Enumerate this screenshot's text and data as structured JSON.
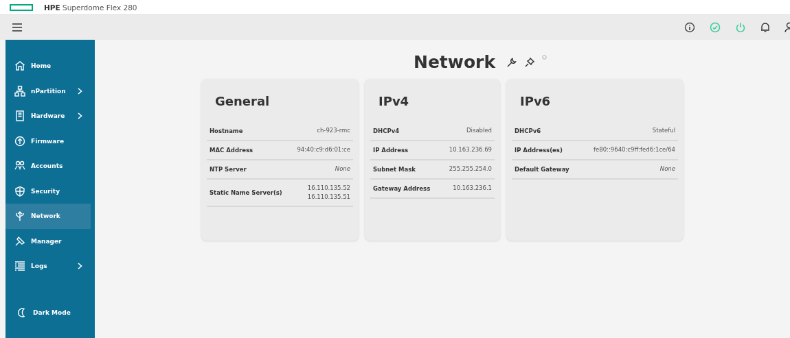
{
  "titlebar": {
    "brand": "HPE",
    "product": "Superdome Flex 280"
  },
  "sidebar": {
    "items": [
      {
        "label": "Home",
        "selected": false,
        "submenu": false
      },
      {
        "label": "nPartition",
        "selected": false,
        "submenu": true
      },
      {
        "label": "Hardware",
        "selected": false,
        "submenu": true
      },
      {
        "label": "Firmware",
        "selected": false,
        "submenu": false
      },
      {
        "label": "Accounts",
        "selected": false,
        "submenu": false
      },
      {
        "label": "Security",
        "selected": false,
        "submenu": false
      },
      {
        "label": "Network",
        "selected": true,
        "submenu": false
      },
      {
        "label": "Manager",
        "selected": false,
        "submenu": false
      },
      {
        "label": "Logs",
        "selected": false,
        "submenu": true
      }
    ],
    "dark_mode": "Dark Mode"
  },
  "page": {
    "title": "Network"
  },
  "cards": [
    {
      "title": "General",
      "rows": [
        {
          "label": "Hostname",
          "values": [
            "ch-923-rmc"
          ],
          "kind": "text"
        },
        {
          "label": "MAC Address",
          "values": [
            "94:40:c9:d6:01:ce"
          ],
          "kind": "text"
        },
        {
          "label": "NTP Server",
          "values": [
            "None"
          ],
          "kind": "none"
        },
        {
          "label": "Static Name Server(s)",
          "values": [
            "16.110.135.52",
            "16.110.135.51"
          ],
          "kind": "text"
        }
      ]
    },
    {
      "title": "IPv4",
      "rows": [
        {
          "label": "DHCPv4",
          "values": [
            "Disabled"
          ],
          "kind": "text"
        },
        {
          "label": "IP Address",
          "values": [
            "10.163.236.69"
          ],
          "kind": "text"
        },
        {
          "label": "Subnet Mask",
          "values": [
            "255.255.254.0"
          ],
          "kind": "text"
        },
        {
          "label": "Gateway Address",
          "values": [
            "10.163.236.1"
          ],
          "kind": "text"
        }
      ]
    },
    {
      "title": "IPv6",
      "rows": [
        {
          "label": "DHCPv6",
          "values": [
            "Stateful"
          ],
          "kind": "text"
        },
        {
          "label": "IP Address(es)",
          "values": [
            "fe80::9640:c9ff:fed6:1ce/64"
          ],
          "kind": "text"
        },
        {
          "label": "Default Gateway",
          "values": [
            "None"
          ],
          "kind": "none"
        }
      ]
    }
  ]
}
